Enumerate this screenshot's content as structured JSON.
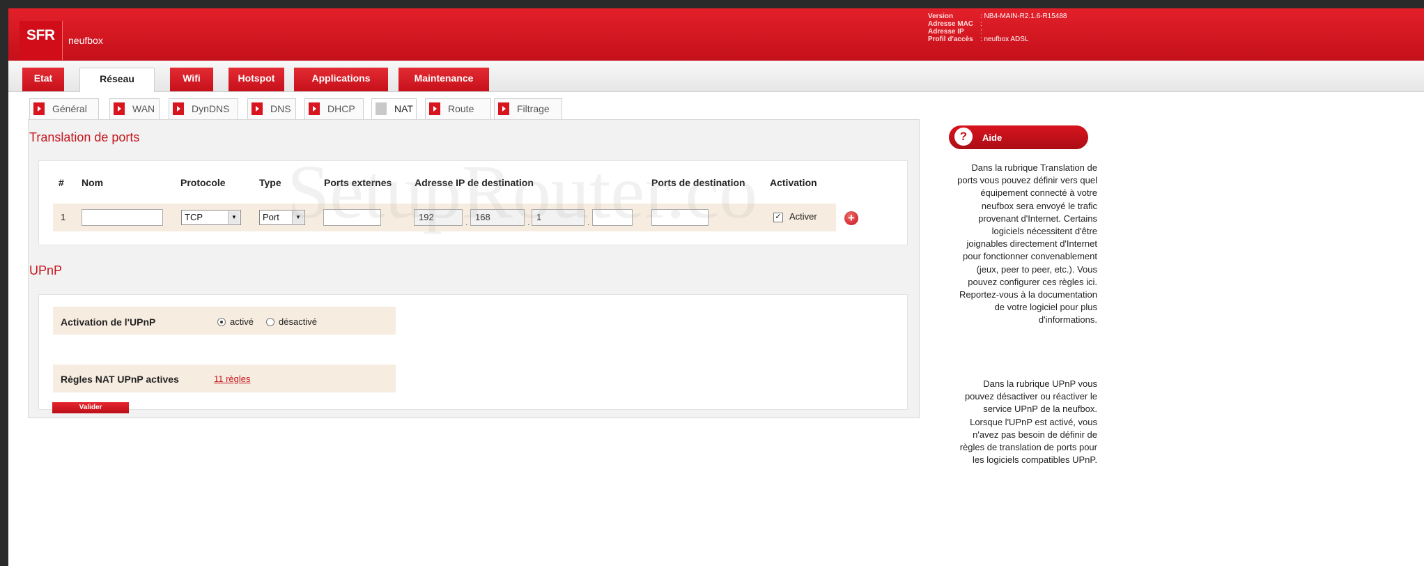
{
  "header": {
    "logo": "SFR",
    "brand": "neufbox",
    "info": [
      {
        "label": "Version",
        "value": ": NB4-MAIN-R2.1.6-R15488"
      },
      {
        "label": "Adresse MAC",
        "value": ":"
      },
      {
        "label": "Adresse IP",
        "value": ":"
      },
      {
        "label": "Profil d'accès",
        "value": ": neufbox ADSL"
      }
    ]
  },
  "main_tabs": [
    "Etat",
    "Réseau",
    "Wifi",
    "Hotspot",
    "Applications",
    "Maintenance"
  ],
  "main_active": "Réseau",
  "sub_tabs": [
    "Général",
    "WAN",
    "DynDNS",
    "DNS",
    "DHCP",
    "NAT",
    "Route",
    "Filtrage"
  ],
  "sub_active": "NAT",
  "ports": {
    "title": "Translation de ports",
    "headers": [
      "#",
      "Nom",
      "Protocole",
      "Type",
      "Ports externes",
      "Adresse IP de destination",
      "Ports de destination",
      "Activation"
    ],
    "row": {
      "num": "1",
      "nom": "",
      "protocole": "TCP",
      "type": "Port",
      "ports_externes": "",
      "ip": [
        "192",
        "168",
        "1",
        ""
      ],
      "ports_destination": "",
      "activer_label": "Activer",
      "activer_checked": true
    }
  },
  "upnp": {
    "title": "UPnP",
    "activation_label": "Activation de l'UPnP",
    "option_on": "activé",
    "option_off": "désactivé",
    "selected": "activé",
    "rules_label": "Règles NAT UPnP actives",
    "rules_link": "11 règles",
    "submit": "Valider"
  },
  "help": {
    "title": "Aide",
    "icon": "question-icon",
    "p1_lines": [
      "Dans la rubrique Translation de",
      "ports vous pouvez définir vers quel",
      "équipement connecté à votre",
      "neufbox sera envoyé le trafic",
      "provenant d'Internet. Certains",
      "logiciels nécessitent d'être",
      "joignables directement d'Internet",
      "pour fonctionner convenablement",
      "(jeux, peer to peer, etc.). Vous",
      "pouvez configurer ces règles ici.",
      "Reportez-vous à la documentation",
      "de votre logiciel pour plus",
      "d'informations."
    ],
    "p2_lines": [
      "Dans la rubrique UPnP vous",
      "pouvez désactiver ou réactiver le",
      "service UPnP de la neufbox.",
      "Lorsque l'UPnP est activé, vous",
      "n'avez pas besoin de définir de",
      "règles de translation de ports pour",
      "les logiciels compatibles UPnP."
    ]
  },
  "watermark": "SetupRouter.co",
  "colors": {
    "brand_red": "#d8141e",
    "row_beige": "#f7ece0",
    "panel_gray": "#f2f2f2"
  }
}
